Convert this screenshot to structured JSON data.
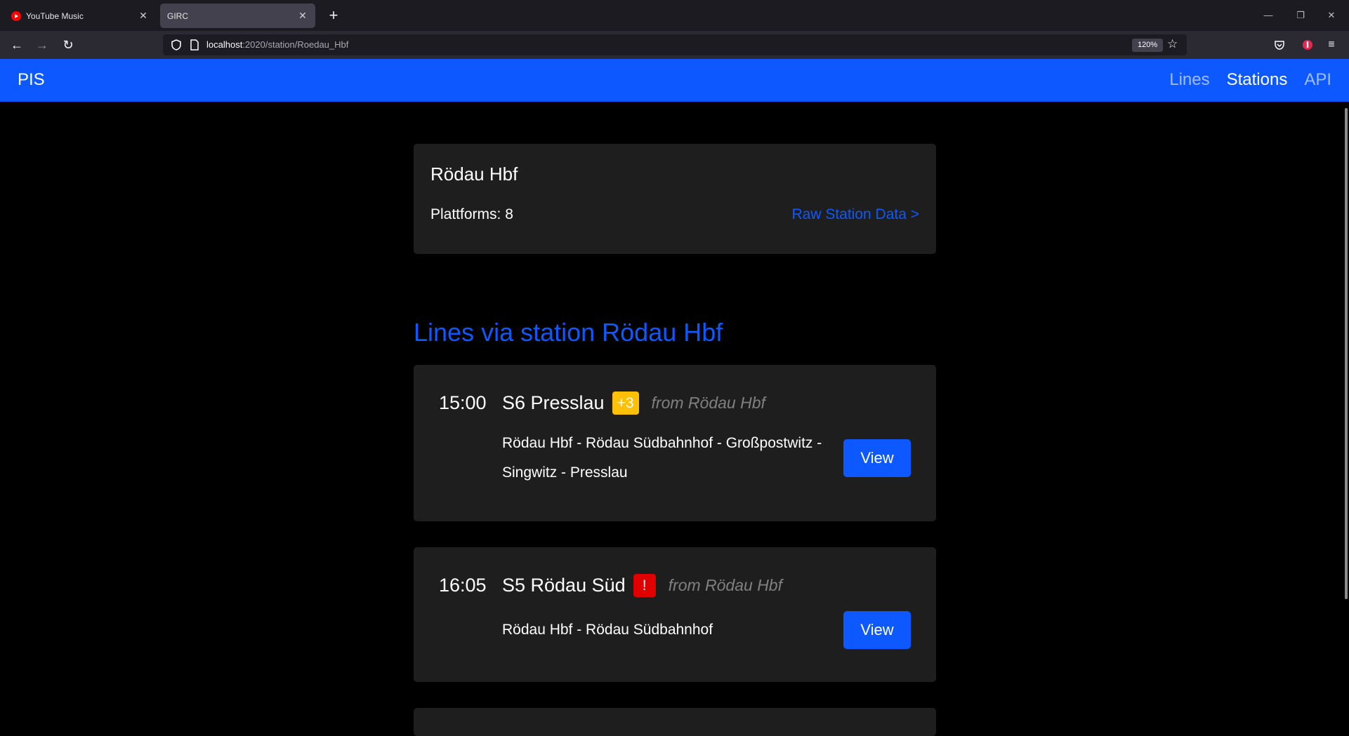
{
  "browser": {
    "tabs": [
      {
        "title": "YouTube Music",
        "icon": "youtube-icon",
        "active": false
      },
      {
        "title": "GIRC",
        "icon": "",
        "active": true
      }
    ],
    "new_tab_symbol": "+",
    "window_controls": {
      "minimize": "—",
      "restore": "❐",
      "close": "✕"
    },
    "url": {
      "host": "localhost",
      "rest": ":2020/station/Roedau_Hbf"
    },
    "zoom": "120%"
  },
  "app": {
    "brand": "PIS",
    "nav": [
      {
        "label": "Lines",
        "active": false
      },
      {
        "label": "Stations",
        "active": true
      },
      {
        "label": "API",
        "active": false
      }
    ],
    "colors": {
      "primary": "#0d59ff",
      "card": "#1e1e1e",
      "delay": "#ffc107",
      "alert": "#e00000"
    }
  },
  "station": {
    "name": "Rödau Hbf",
    "platforms_label": "Plattforms: 8",
    "raw_link": "Raw Station Data >"
  },
  "lines_section": {
    "title": "Lines via station Rödau Hbf",
    "lines": [
      {
        "time": "15:00",
        "name": "S6 Presslau",
        "badge": "+3",
        "badge_type": "delay",
        "origin": "from Rödau Hbf",
        "route": "Rödau Hbf - Rödau Südbahnhof - Großpostwitz - Singwitz - Presslau",
        "view_label": "View"
      },
      {
        "time": "16:05",
        "name": "S5 Rödau Süd",
        "badge": "!",
        "badge_type": "alert",
        "origin": "from Rödau Hbf",
        "route": "Rödau Hbf - Rödau Südbahnhof",
        "view_label": "View"
      }
    ]
  }
}
